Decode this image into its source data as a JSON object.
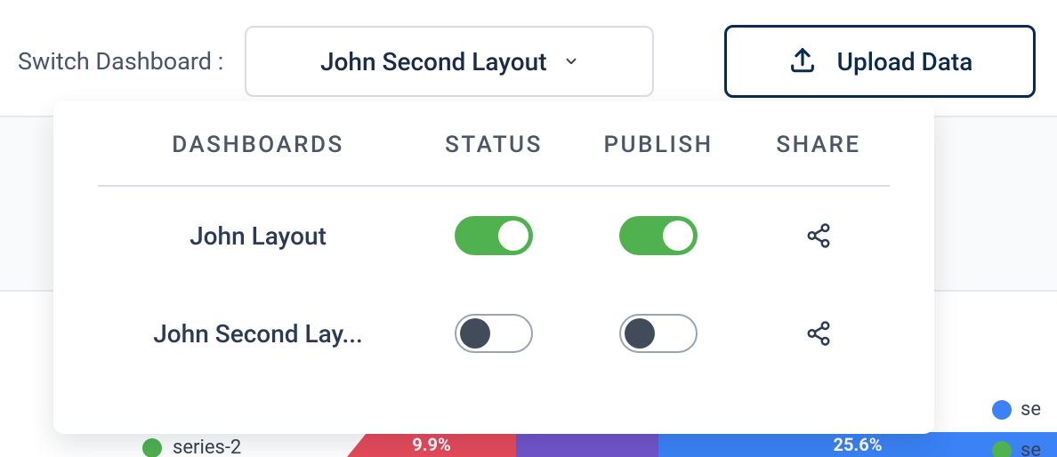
{
  "header": {
    "switch_label": "Switch Dashboard :",
    "selected_dashboard": "John Second Layout",
    "upload_label": "Upload Data"
  },
  "panel": {
    "columns": {
      "dashboards": "DASHBOARDS",
      "status": "STATUS",
      "publish": "PUBLISH",
      "share": "SHARE"
    },
    "rows": [
      {
        "name": "John Layout",
        "status_on": true,
        "publish_on": true
      },
      {
        "name": "John Second Lay...",
        "status_on": false,
        "publish_on": false
      }
    ]
  },
  "background": {
    "legend": [
      {
        "label": "se",
        "color": "#3b82f6"
      },
      {
        "label": "se",
        "color": "#4fb24f"
      }
    ],
    "series2_label": "series-2",
    "segments": {
      "red_pct": "9.9%",
      "blue_pct": "25.6%"
    }
  },
  "colors": {
    "border": "#d9dde3",
    "navy": "#0b2a52",
    "toggle_on": "#4fb24f",
    "toggle_off_knob": "#414b5a"
  }
}
